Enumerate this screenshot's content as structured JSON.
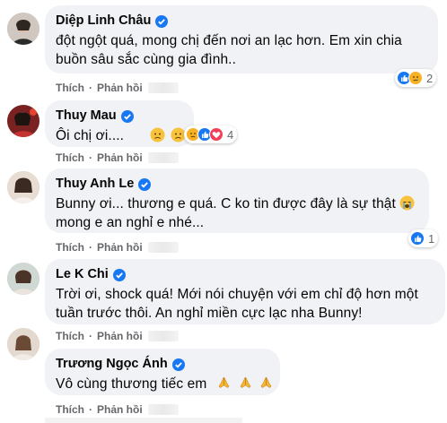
{
  "comments": [
    {
      "author": "Diệp Linh Châu",
      "text": "đột ngột quá, mong chị đến nơi an lạc hơn. Em xin chia buồn sâu sắc cùng gia đình..",
      "like_label": "Thích",
      "reply_label": "Phản hồi",
      "reaction_count": "2",
      "reactions": [
        "like",
        "sad"
      ]
    },
    {
      "author": "Thuy Mau",
      "text": "Ôi chị ơi....",
      "emojis": [
        "sad-face",
        "sad-face",
        "sad-face"
      ],
      "like_label": "Thích",
      "reply_label": "Phản hồi",
      "reaction_count": "4",
      "reactions": [
        "sad",
        "like",
        "love"
      ]
    },
    {
      "author": "Thuy Anh Le",
      "text_line1": "Bunny ơi... thương e quá. C ko tin được đây là sự thật",
      "text_line2": "mong e an nghỉ e nhé...",
      "emojis": [
        "crying-face"
      ],
      "like_label": "Thích",
      "reply_label": "Phản hồi",
      "reaction_count": "1",
      "reactions": [
        "like"
      ]
    },
    {
      "author": "Le K Chi",
      "text": "Trời ơi, shock quá! Mới nói chuyện với em chỉ độ hơn một tuần trước thôi. An nghỉ miền cực lạc nha Bunny!",
      "like_label": "Thích",
      "reply_label": "Phản hồi"
    },
    {
      "author": "Trương Ngọc Ánh",
      "text": "Vô cùng thương tiếc em",
      "emojis": [
        "folded-hands",
        "folded-hands",
        "folded-hands"
      ],
      "like_label": "Thích",
      "reply_label": "Phản hồi"
    }
  ],
  "colors": {
    "bubble": "#f0f2f5",
    "verified": "#1877f2",
    "like": "#1877f2",
    "love": "#f33e58",
    "sad": "#f7b125",
    "meta_text": "#65676b"
  }
}
